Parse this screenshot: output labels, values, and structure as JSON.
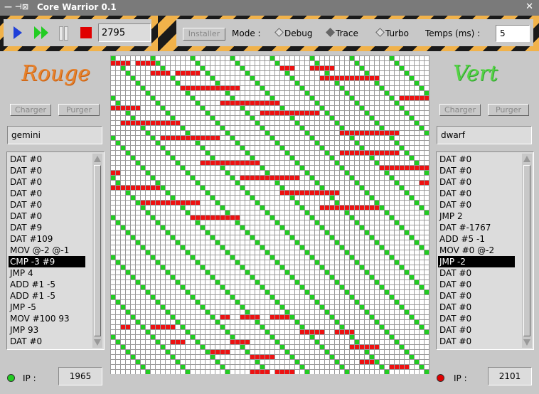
{
  "window": {
    "title": "Core Warrior 0.1",
    "controls": "— ⊣⊠",
    "close": "✕"
  },
  "toolbar": {
    "cycle_count": "2795",
    "install_label": "Installer",
    "mode_label": "Mode :",
    "modes": [
      {
        "label": "Debug",
        "selected": false
      },
      {
        "label": "Trace",
        "selected": true
      },
      {
        "label": "Turbo",
        "selected": false
      }
    ],
    "time_label": "Temps (ms) :",
    "time_value": "5"
  },
  "red_player": {
    "name_logo": "Rouge",
    "load_label": "Charger",
    "purge_label": "Purger",
    "warrior_name": "gemini",
    "instructions": [
      "DAT #0",
      "DAT #0",
      "DAT #0",
      "DAT #0",
      "DAT #0",
      "DAT #0",
      "DAT #9",
      "DAT #109",
      "MOV @-2 @-1",
      "CMP -3 #9",
      "JMP 4",
      "ADD #1 -5",
      "ADD #1 -5",
      "JMP -5",
      "MOV #100 93",
      "JMP 93",
      "DAT #0"
    ],
    "selected_index": 9,
    "ip_label": "IP :",
    "ip_value": "1965",
    "indicator_color": "#22cc22"
  },
  "green_player": {
    "name_logo": "Vert",
    "load_label": "Charger",
    "purge_label": "Purger",
    "warrior_name": "dwarf",
    "instructions": [
      "DAT #0",
      "DAT #0",
      "DAT #0",
      "DAT #0",
      "DAT #0",
      "JMP 2",
      "DAT #-1767",
      "ADD #5 -1",
      "MOV #0 @-2",
      "JMP -2",
      "DAT #0",
      "DAT #0",
      "DAT #0",
      "DAT #0",
      "DAT #0",
      "DAT #0",
      "DAT #0"
    ],
    "selected_index": 9,
    "ip_label": "IP :",
    "ip_value": "2101",
    "indicator_color": "#e00000"
  },
  "core_memory": {
    "grid_color": "#9a9a9a",
    "cell_background": "#ffffff",
    "red_color": "#ee1111",
    "green_color": "#22cc22"
  }
}
